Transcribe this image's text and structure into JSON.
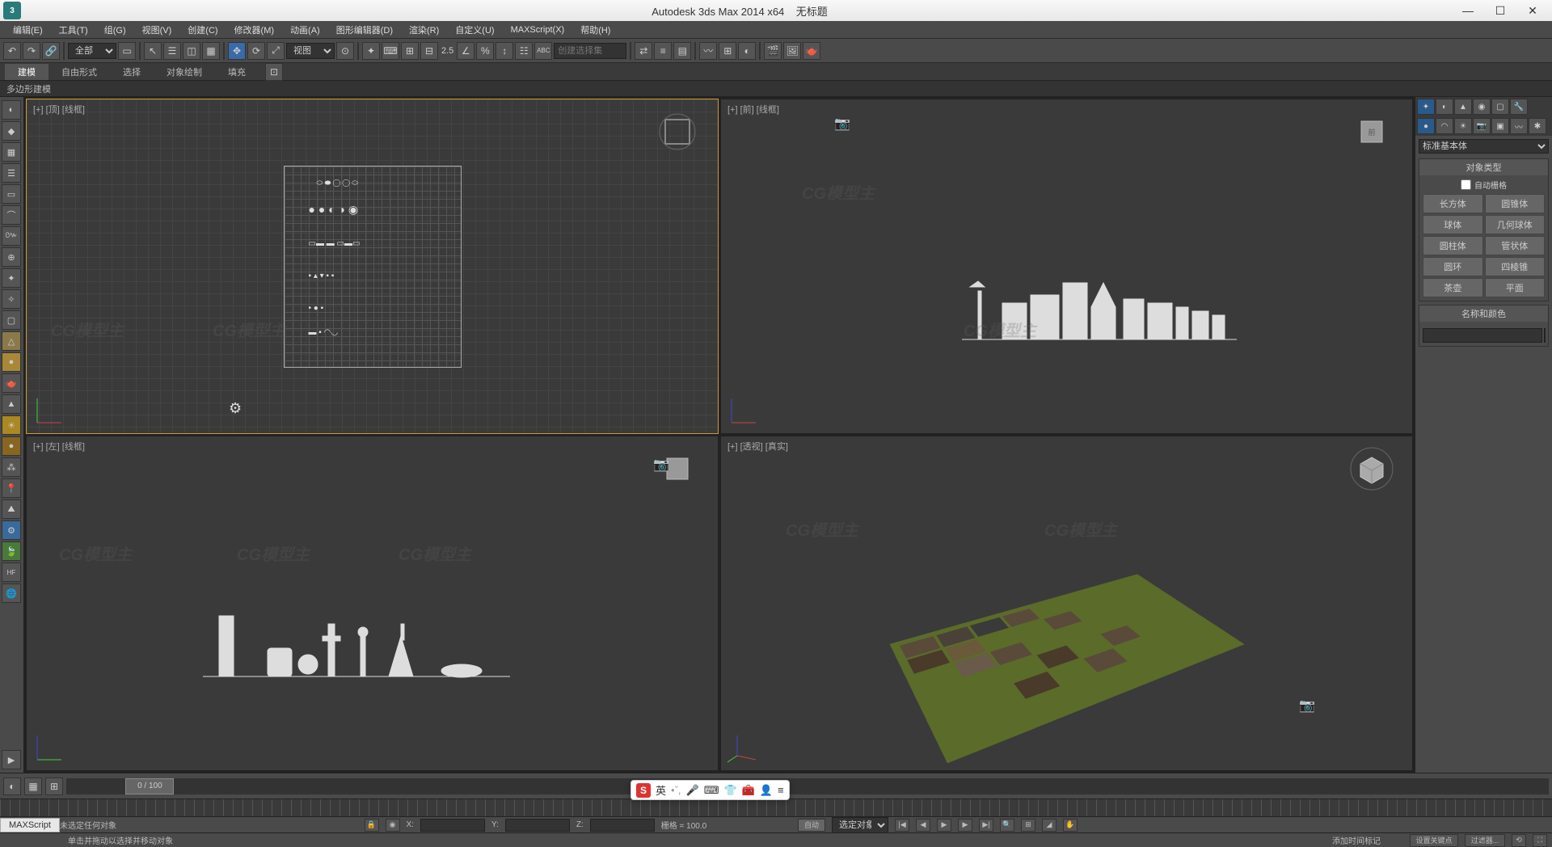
{
  "titlebar": {
    "app_name": "Autodesk 3ds Max  2014 x64",
    "doc_title": "无标题"
  },
  "menu": [
    "编辑(E)",
    "工具(T)",
    "组(G)",
    "视图(V)",
    "创建(C)",
    "修改器(M)",
    "动画(A)",
    "图形编辑器(D)",
    "渲染(R)",
    "自定义(U)",
    "MAXScript(X)",
    "帮助(H)"
  ],
  "toolbar": {
    "all_dropdown": "全部",
    "view_dropdown": "视图",
    "angle_value": "2.5",
    "selset_placeholder": "创建选择集"
  },
  "ribbon": {
    "tabs": [
      "建模",
      "自由形式",
      "选择",
      "对象绘制",
      "填充"
    ],
    "sub": "多边形建模"
  },
  "viewports": {
    "top": "[+] [顶] [线框]",
    "front": "[+] [前] [线框]",
    "left": "[+] [左] [线框]",
    "persp": "[+] [透视] [真实]"
  },
  "cmdpanel": {
    "dropdown": "标准基本体",
    "rollout_type": "对象类型",
    "auto_grid": "自动栅格",
    "primitives": [
      "长方体",
      "圆锥体",
      "球体",
      "几何球体",
      "圆柱体",
      "管状体",
      "圆环",
      "四棱锥",
      "茶壶",
      "平面"
    ],
    "rollout_name": "名称和颜色"
  },
  "timeline": {
    "frame": "0 / 100"
  },
  "status": {
    "no_selection": "未选定任何对象",
    "hint": "单击并拖动以选择并移动对象",
    "x_label": "X:",
    "y_label": "Y:",
    "z_label": "Z:",
    "grid_label": "栅格 = 100.0",
    "auto_label": "自动",
    "sel_obj": "选定对象",
    "add_time": "添加时间标记",
    "set_key": "设置关键点",
    "filter": "过滤器..."
  },
  "ime": {
    "logo": "S",
    "lang": "英"
  },
  "maxscript_tab": "MAXScript",
  "watermark": "CG模型主"
}
